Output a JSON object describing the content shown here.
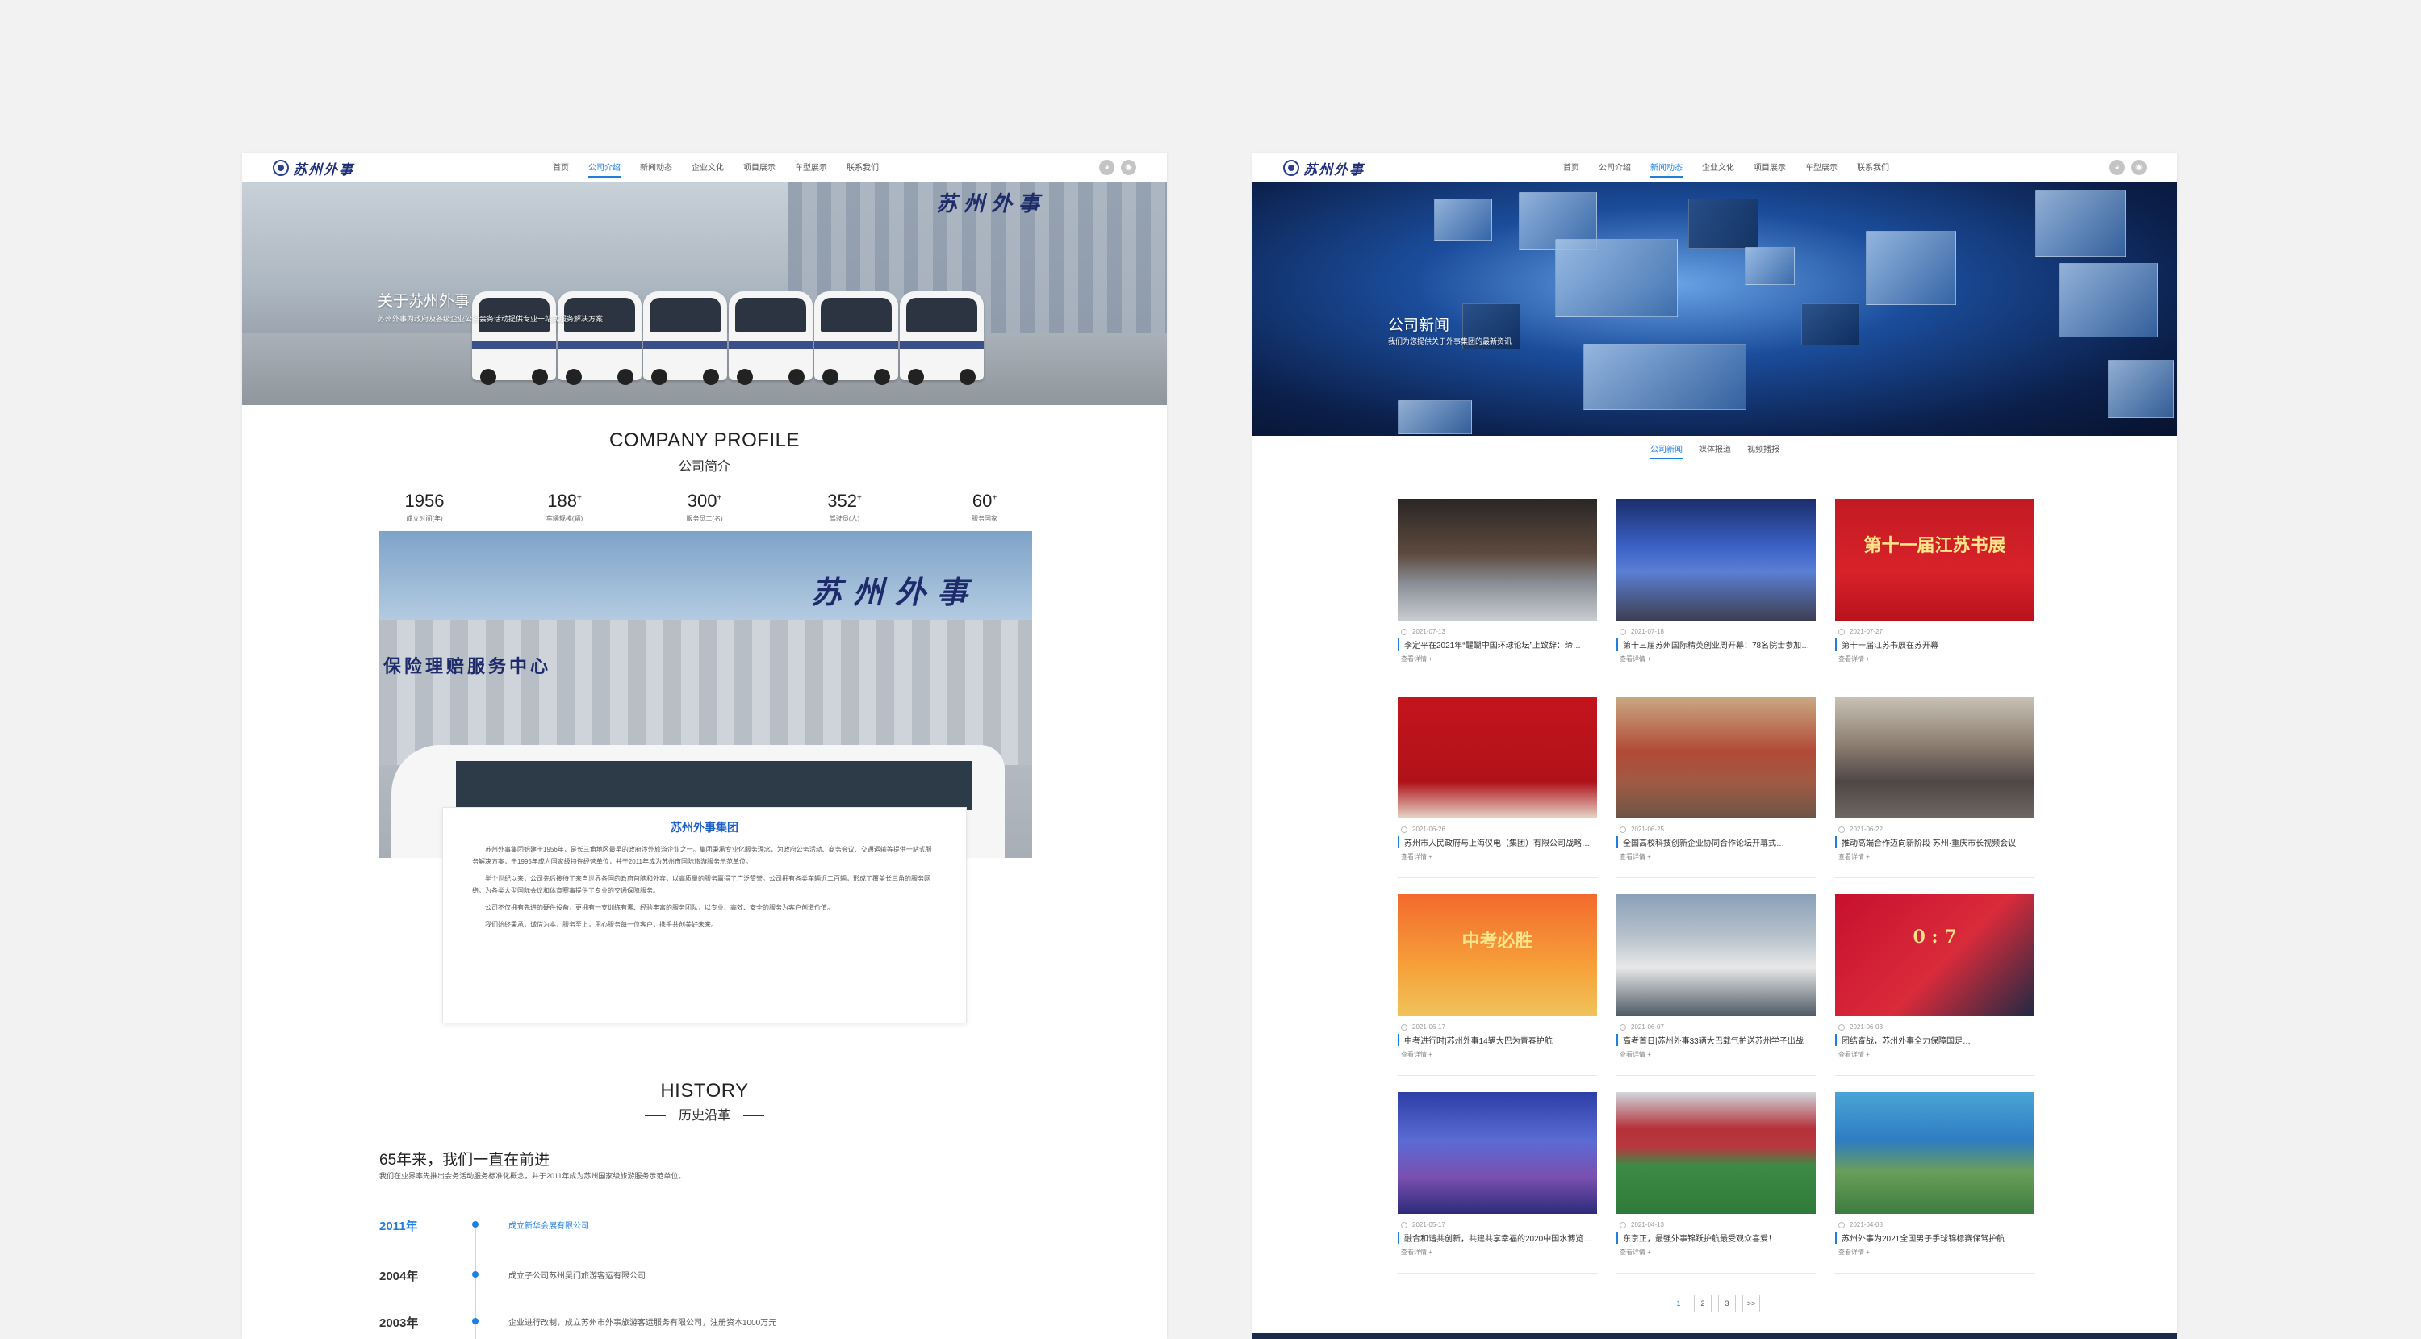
{
  "logo_text": "苏州外事",
  "menu": [
    "首页",
    "公司介绍",
    "新闻动态",
    "企业文化",
    "项目展示",
    "车型展示",
    "联系我们"
  ],
  "page1": {
    "active_menu": 1,
    "banner_title": "关于苏州外事",
    "banner_sub": "苏州外事为政府及各级企业公务会务活动提供专业一站式服务解决方案",
    "profile_en": "COMPANY PROFILE",
    "profile_cn": "公司简介",
    "stats": [
      {
        "num": "1956",
        "plus": "",
        "label": "成立时间(年)"
      },
      {
        "num": "188",
        "plus": "+",
        "label": "车辆规模(辆)"
      },
      {
        "num": "300",
        "plus": "+",
        "label": "服务员工(名)"
      },
      {
        "num": "352",
        "plus": "+",
        "label": "驾驶员(人)"
      },
      {
        "num": "60",
        "plus": "+",
        "label": "服务国家"
      }
    ],
    "intro_title": "苏州外事集团",
    "intro_paras": [
      "苏州外事集团始建于1956年，是长三角地区最早的政府涉外旅游企业之一。集团秉承专业化服务理念，为政府公务活动、商务会议、交通运输等提供一站式服务解决方案，于1995年成为国家级特许经营单位，并于2011年成为苏州市国际旅游服务示范单位。",
      "半个世纪以来，公司先后接待了来自世界各国的政府首脑和外宾，以高质量的服务赢得了广泛赞誉。公司拥有各类车辆近二百辆，形成了覆盖长三角的服务网络，为各类大型国际会议和体育赛事提供了专业的交通保障服务。",
      "公司不仅拥有先进的硬件设备，更拥有一支训练有素、经验丰富的服务团队，以专业、高效、安全的服务为客户创造价值。",
      "我们始终秉承，诚信为本，服务至上，用心服务每一位客户，携手共创美好未来。"
    ],
    "history_en": "HISTORY",
    "history_cn": "历史沿革",
    "history_title": "65年来，我们一直在前进",
    "history_sub": "我们在业界率先推出会务活动服务标准化概念，并于2011年成为苏州国家级旅游服务示范单位。",
    "timeline": [
      {
        "year": "2011年",
        "event": "成立新华会展有限公司",
        "active": true
      },
      {
        "year": "2004年",
        "event": "成立子公司苏州吴门旅游客运有限公司",
        "active": false
      },
      {
        "year": "2003年",
        "event": "企业进行改制，成立苏州市外事旅游客运服务有限公司，注册资本1000万元",
        "active": false
      }
    ]
  },
  "page2": {
    "active_menu": 2,
    "banner_title": "公司新闻",
    "banner_sub": "我们为您提供关于外事集团的最新资讯",
    "tabs": [
      "公司新闻",
      "媒体报道",
      "视频播报"
    ],
    "active_tab": 0,
    "cards": [
      {
        "date": "2021-07-13",
        "title": "李定平在2021年“醒醐中国环球论坛”上致辞：缔…",
        "more": "查看详情 +",
        "bg": "linear-gradient(180deg,#2a2626 0%,#5d4a3e 45%,#8a8f97 70%,#c9cdd2 100%)",
        "overlay": ""
      },
      {
        "date": "2021-07-18",
        "title": "第十三届苏州国际精英创业周开幕：78名院士参加…",
        "more": "查看详情 +",
        "bg": "linear-gradient(180deg,#1b2d6b 0%,#3b63c8 40%,#5a7fd3 60%,#3e3e52 100%)",
        "overlay": ""
      },
      {
        "date": "2021-07-27",
        "title": "第十一届江苏书展在苏开幕",
        "more": "查看详情 +",
        "bg": "linear-gradient(180deg,#c21a22 0%,#d9222a 60%,#b8121c 100%)",
        "overlay": "第十一届江苏书展"
      },
      {
        "date": "2021-06-26",
        "title": "苏州市人民政府与上海仪电（集团）有限公司战略…",
        "more": "查看详情 +",
        "bg": "linear-gradient(180deg,#c4141c 0%,#b0121a 70%,#e6d6c8 100%)",
        "overlay": ""
      },
      {
        "date": "2021-06-25",
        "title": "全国高校科技创新企业协同合作论坛开幕式…",
        "more": "查看详情 +",
        "bg": "linear-gradient(180deg,#c9a982 0%,#b24a37 45%,#a05a44 70%,#6d5547 100%)",
        "overlay": ""
      },
      {
        "date": "2021-06-22",
        "title": "推动高端合作迈向新阶段 苏州·重庆市长视频会议",
        "more": "查看详情 +",
        "bg": "linear-gradient(180deg,#c8c2b5 0%,#8c7d70 40%,#4f4646 70%,#6d6862 100%)",
        "overlay": ""
      },
      {
        "date": "2021-06-17",
        "title": "中考进行时|苏州外事14辆大巴为青春护航",
        "more": "查看详情 +",
        "bg": "linear-gradient(180deg,#f36a2d 0%,#f6a13a 60%,#f0c35b 100%)",
        "overlay": "中考必胜"
      },
      {
        "date": "2021-06-07",
        "title": "高考首日|苏州外事33辆大巴载气护送苏州学子出战",
        "more": "查看详情 +",
        "bg": "linear-gradient(180deg,#8aa0b8 0%,#b7c2cc 35%,#e8e8e8 60%,#4e5a66 100%)",
        "overlay": ""
      },
      {
        "date": "2021-06-03",
        "title": "团结奋战，苏州外事全力保障国足…",
        "more": "查看详情 +",
        "bg": "linear-gradient(135deg,#c8102e 0%,#d92b3a 55%,#1f2a44 100%)",
        "overlay": "0 : 7"
      },
      {
        "date": "2021-05-17",
        "title": "融合和谐共创新，共建共享幸福的2020中国水博览…",
        "more": "查看详情 +",
        "bg": "linear-gradient(180deg,#2c3fa5 0%,#5b6bd4 40%,#7a4fb0 70%,#2c2c7a 100%)",
        "overlay": ""
      },
      {
        "date": "2021-04-13",
        "title": "东京正，最强外事锦跃护航最受观众喜爱！",
        "more": "查看详情 +",
        "bg": "linear-gradient(180deg,#d1d7dd 0%,#b5313a 30%,#b8373f 45%,#3d8b45 60%,#2f7a3a 100%)",
        "overlay": ""
      },
      {
        "date": "2021-04-08",
        "title": "苏州外事为2021全国男子手球锦标赛保驾护航",
        "more": "查看详情 +",
        "bg": "linear-gradient(180deg,#4aa5d6 0%,#2e7cc2 40%,#6b9e5a 65%,#3b7d3e 100%)",
        "overlay": ""
      }
    ],
    "pager": [
      "1",
      "2",
      "3",
      ">>"
    ],
    "active_page": 0
  }
}
